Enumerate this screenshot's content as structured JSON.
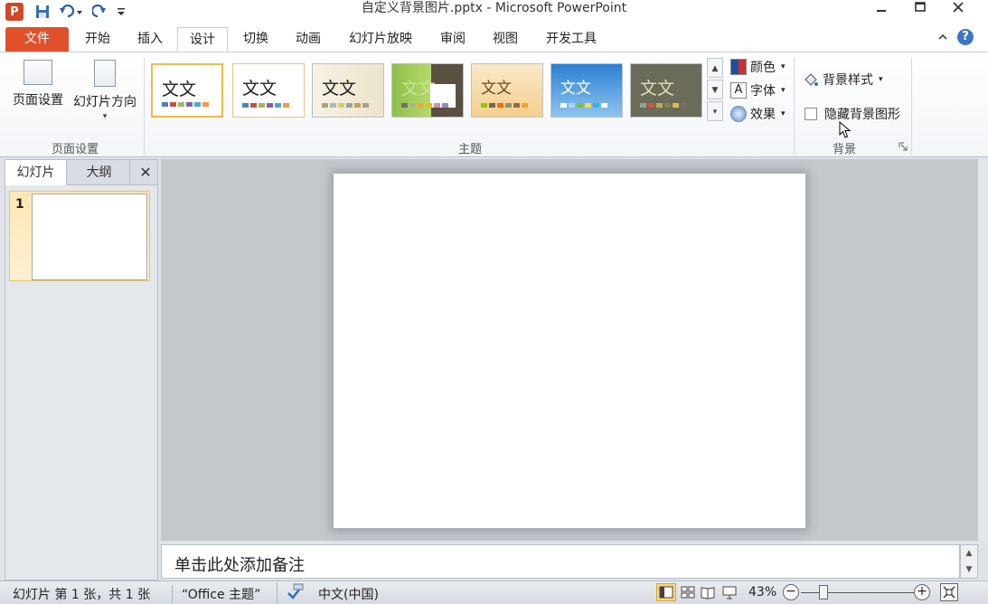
{
  "window": {
    "title": "自定义背景图片.pptx - Microsoft PowerPoint",
    "app_logo": "P"
  },
  "tabs": [
    {
      "label": "文件"
    },
    {
      "label": "开始"
    },
    {
      "label": "插入"
    },
    {
      "label": "设计"
    },
    {
      "label": "切换"
    },
    {
      "label": "动画"
    },
    {
      "label": "幻灯片放映"
    },
    {
      "label": "审阅"
    },
    {
      "label": "视图"
    },
    {
      "label": "开发工具"
    }
  ],
  "ribbon": {
    "page_setup": {
      "label": "页面设置",
      "page_setup_button": "页面设置",
      "orientation_button": "幻灯片方向"
    },
    "themes": {
      "label": "主题",
      "thumbnail_text": "文文",
      "colors": "颜色",
      "fonts": "字体",
      "effects": "效果"
    },
    "background": {
      "label": "背景",
      "styles": "背景样式",
      "hide_graphics": "隐藏背景图形"
    }
  },
  "left_pane": {
    "tab_slides": "幻灯片",
    "tab_outline": "大纲",
    "close": "✕",
    "slide_number": "1"
  },
  "notes": {
    "placeholder": "单击此处添加备注"
  },
  "status": {
    "slide_info": "幻灯片 第 1 张，共 1 张",
    "theme": "“Office 主题”",
    "language": "中文(中国)",
    "zoom": "43%"
  },
  "colors": {
    "file_tab": "#e0502a",
    "selected_highlight": "#fbd67a"
  }
}
